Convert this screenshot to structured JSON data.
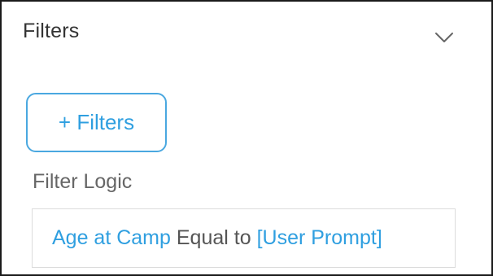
{
  "panel": {
    "title": "Filters"
  },
  "actions": {
    "add_filters_label": "+ Filters"
  },
  "filter_logic": {
    "label": "Filter Logic",
    "field": "Age at Camp",
    "operator": "Equal to",
    "value": "[User Prompt]"
  },
  "icons": {
    "collapse": "chevron-down-icon"
  },
  "colors": {
    "accent": "#2f9fe0",
    "button_border": "#4aa8e0",
    "panel_border": "#1a1a1a",
    "title_text": "#333333",
    "label_text": "#666666",
    "box_border": "#dcdcdc"
  }
}
